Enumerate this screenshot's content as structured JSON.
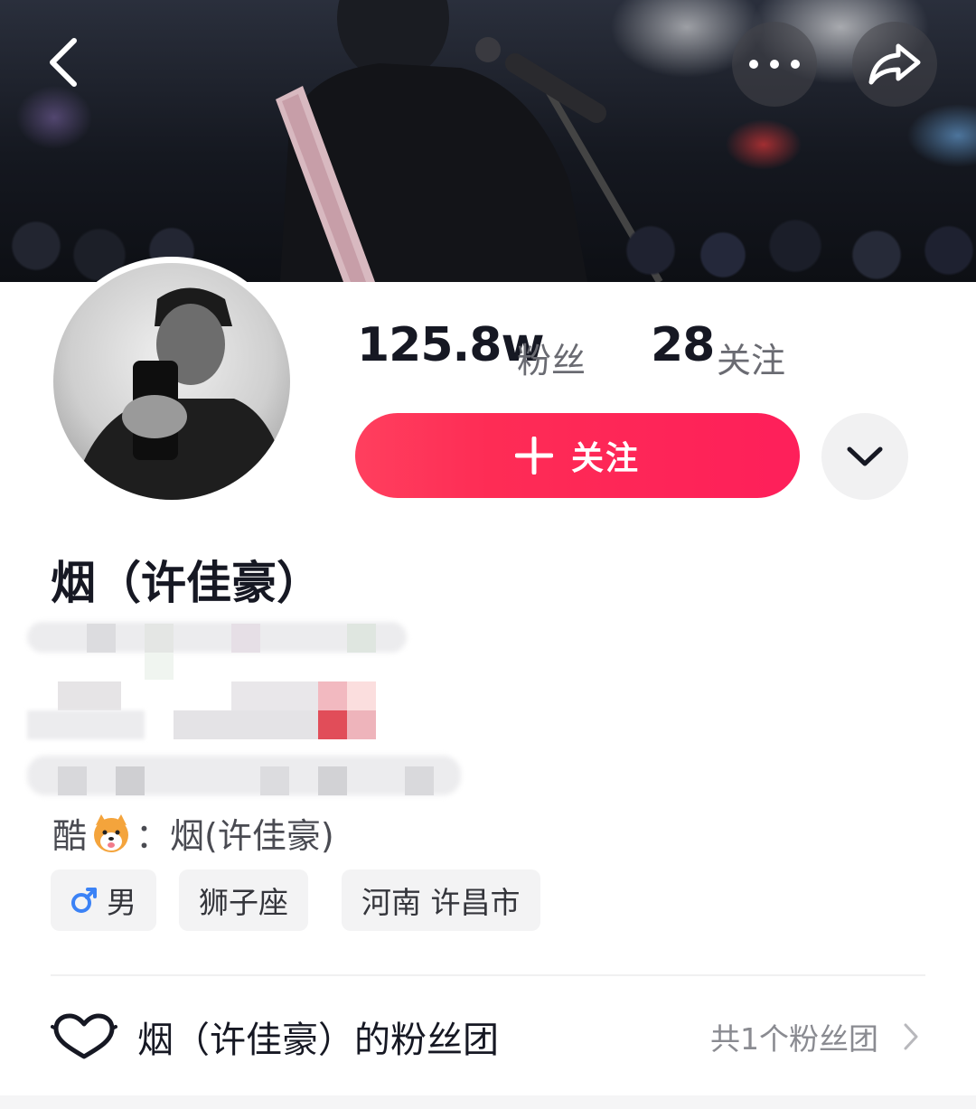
{
  "header": {
    "back_icon": "chevron-left-icon",
    "more_icon": "more-horizontal-icon",
    "share_icon": "share-arrow-icon"
  },
  "stats": {
    "followers_value": "125.8w",
    "followers_label": "粉丝",
    "following_value": "28",
    "following_label": "关注"
  },
  "actions": {
    "follow_label": "关注",
    "follow_color": "#fe2c55",
    "more_icon": "chevron-down-icon"
  },
  "profile": {
    "name": "烟（许佳豪）",
    "bio_prefix": "酷",
    "bio_suffix": "：烟(许佳豪)",
    "bio_emoji": "shiba-dog-emoji"
  },
  "tags": [
    {
      "label": "男",
      "icon": "male-symbol-icon",
      "icon_color": "#3b82f6"
    },
    {
      "label": "狮子座"
    },
    {
      "label": "河南 许昌市"
    }
  ],
  "fan_club": {
    "title": "烟（许佳豪）的粉丝团",
    "count_text": "共1个粉丝团",
    "icon": "heart-outline-icon"
  }
}
